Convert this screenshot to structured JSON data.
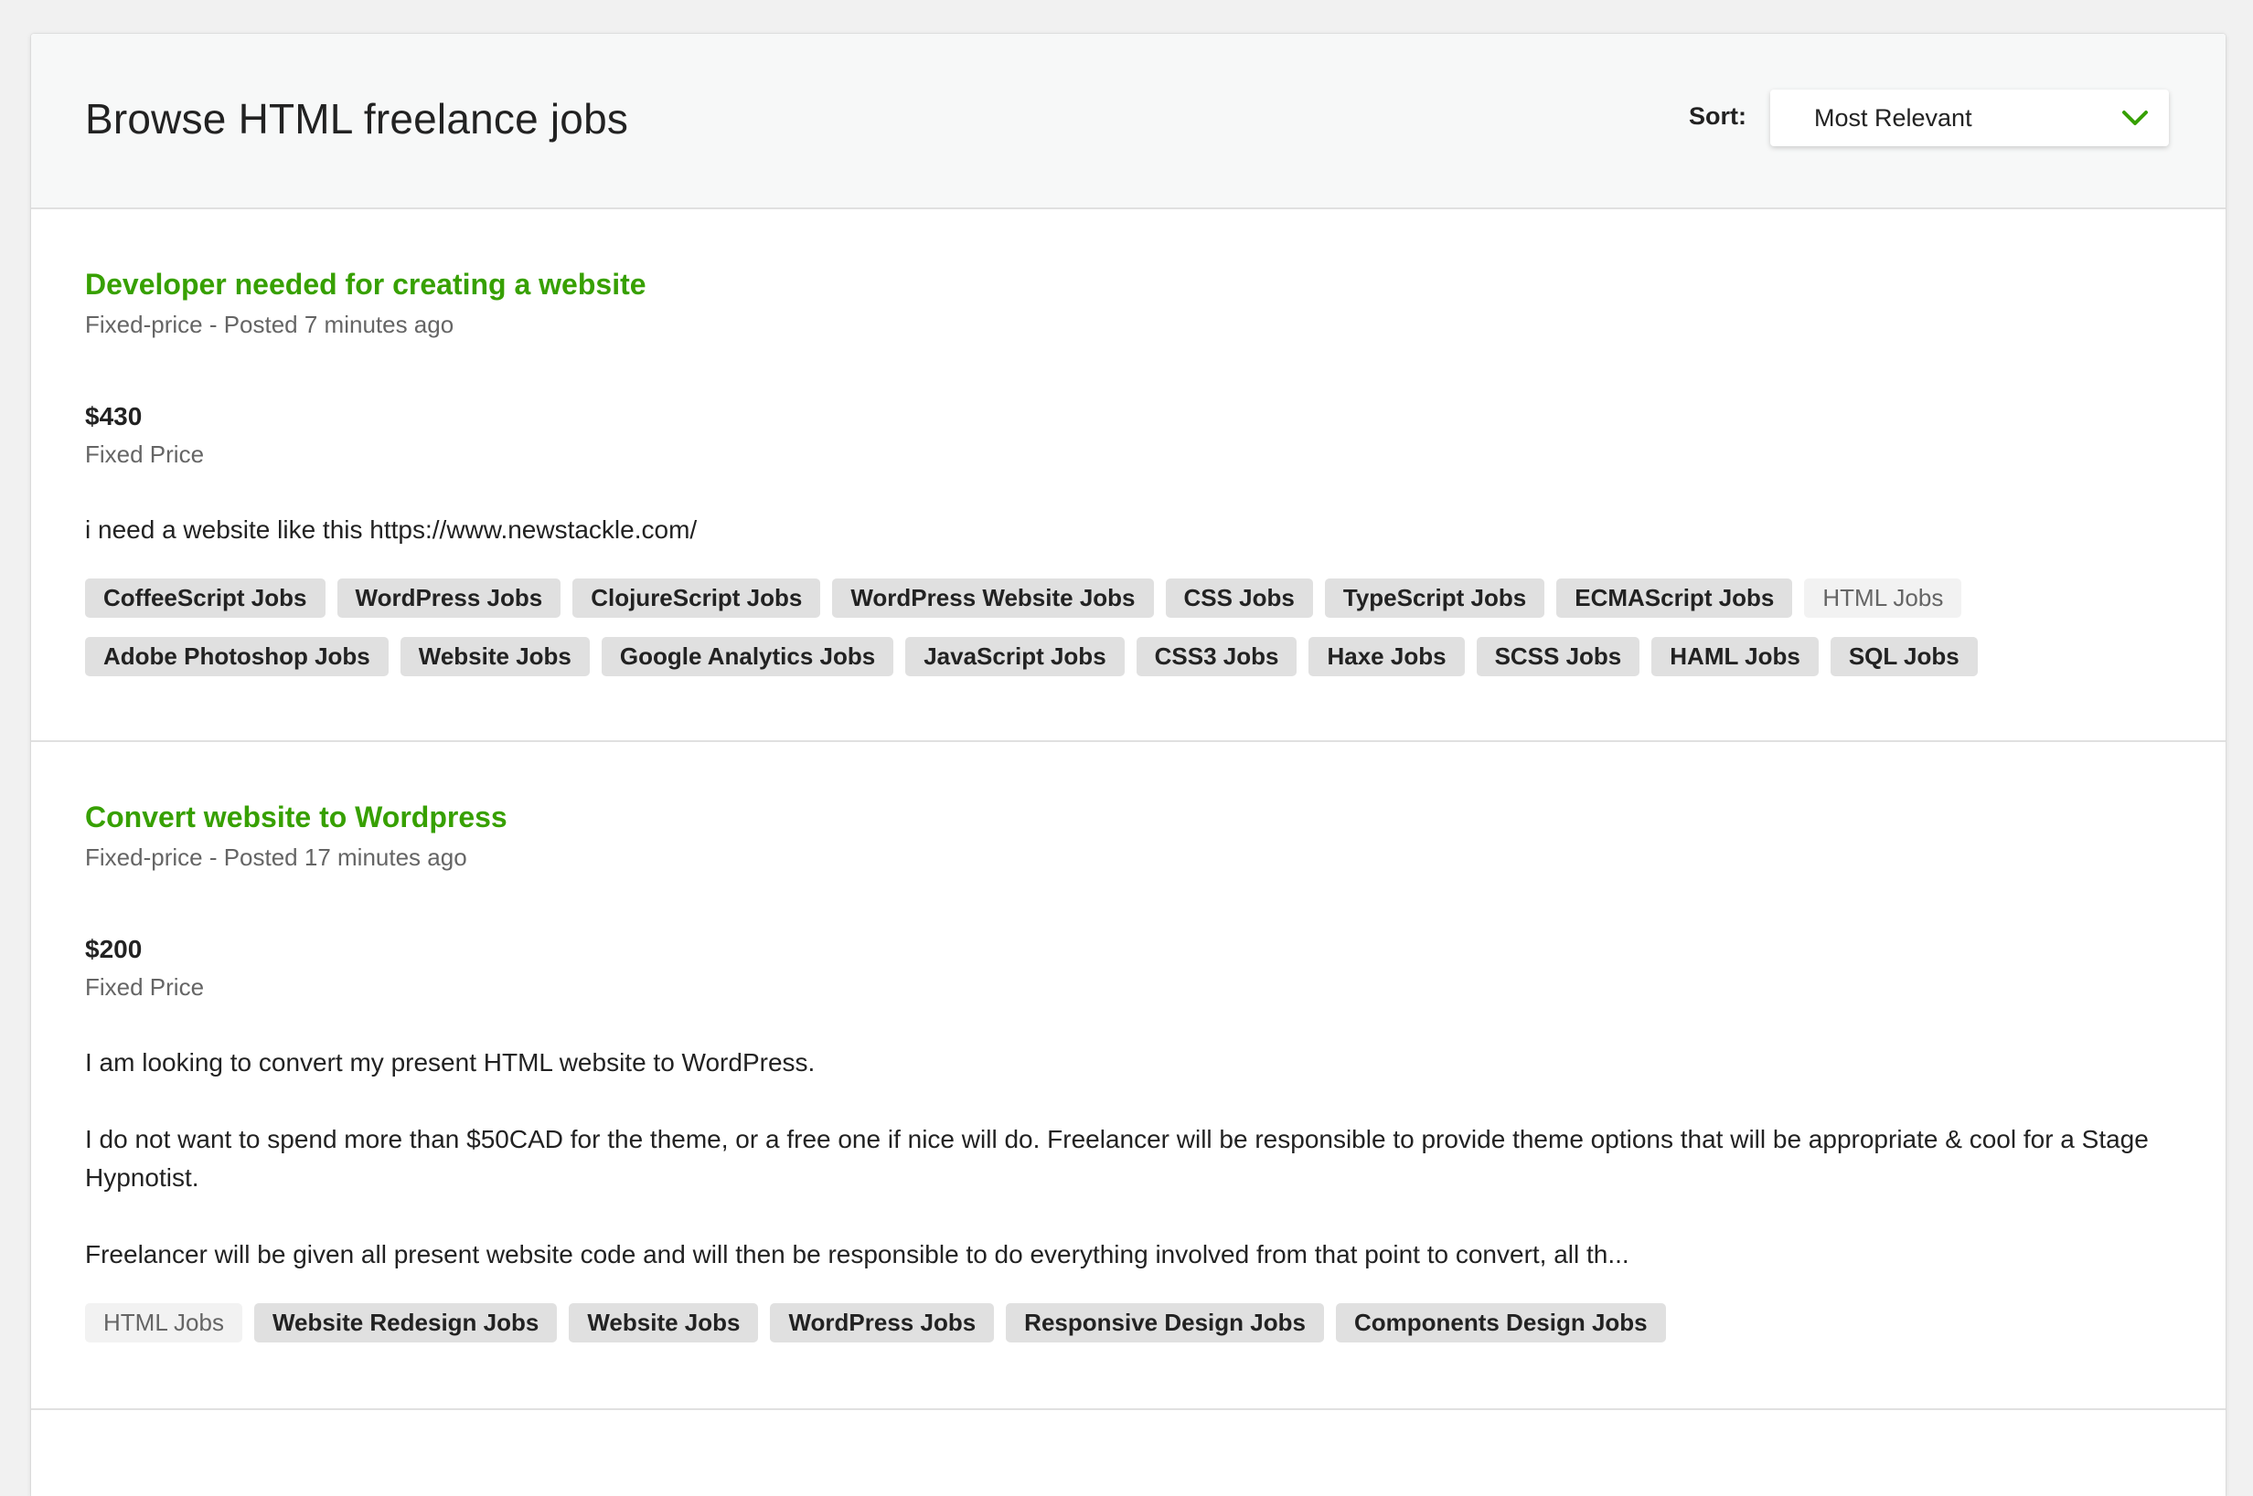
{
  "header": {
    "title": "Browse HTML freelance jobs",
    "sort_label": "Sort:",
    "sort_value": "Most Relevant",
    "sort_icon": "chevron-down-icon"
  },
  "colors": {
    "accent": "#37a000",
    "text": "#222222",
    "muted": "#656565",
    "tag_bg": "#e0e0e0",
    "tag_active_bg": "#f2f2f2",
    "page_bg": "#f1f1f1",
    "header_bg": "#f7f8f8"
  },
  "jobs": [
    {
      "title": "Developer needed for creating a website",
      "meta": "Fixed-price - Posted 7 minutes ago",
      "price": "$430",
      "price_type": "Fixed Price",
      "description": [
        "i need a website like this https://www.newstackle.com/"
      ],
      "tags": [
        {
          "label": "CoffeeScript Jobs",
          "active": false
        },
        {
          "label": "WordPress Jobs",
          "active": false
        },
        {
          "label": "ClojureScript Jobs",
          "active": false
        },
        {
          "label": "WordPress Website Jobs",
          "active": false
        },
        {
          "label": "CSS Jobs",
          "active": false
        },
        {
          "label": "TypeScript Jobs",
          "active": false
        },
        {
          "label": "ECMAScript Jobs",
          "active": false
        },
        {
          "label": "HTML Jobs",
          "active": true
        },
        {
          "label": "Adobe Photoshop Jobs",
          "active": false
        },
        {
          "label": "Website Jobs",
          "active": false
        },
        {
          "label": "Google Analytics Jobs",
          "active": false
        },
        {
          "label": "JavaScript Jobs",
          "active": false
        },
        {
          "label": "CSS3 Jobs",
          "active": false
        },
        {
          "label": "Haxe Jobs",
          "active": false
        },
        {
          "label": "SCSS Jobs",
          "active": false
        },
        {
          "label": "HAML Jobs",
          "active": false
        },
        {
          "label": "SQL Jobs",
          "active": false
        }
      ]
    },
    {
      "title": "Convert website to Wordpress",
      "meta": "Fixed-price - Posted 17 minutes ago",
      "price": "$200",
      "price_type": "Fixed Price",
      "description": [
        "I am looking to convert my present HTML website to WordPress.",
        "I do not want to spend more than $50CAD for the theme, or a free one if nice will do. Freelancer will be responsible to provide theme options that will be appropriate & cool for a Stage Hypnotist.",
        "Freelancer will be given all present website code and will then be responsible to do everything involved from that point to convert, all th..."
      ],
      "tags": [
        {
          "label": "HTML Jobs",
          "active": true
        },
        {
          "label": "Website Redesign Jobs",
          "active": false
        },
        {
          "label": "Website Jobs",
          "active": false
        },
        {
          "label": "WordPress Jobs",
          "active": false
        },
        {
          "label": "Responsive Design Jobs",
          "active": false
        },
        {
          "label": "Components Design Jobs",
          "active": false
        }
      ]
    }
  ]
}
